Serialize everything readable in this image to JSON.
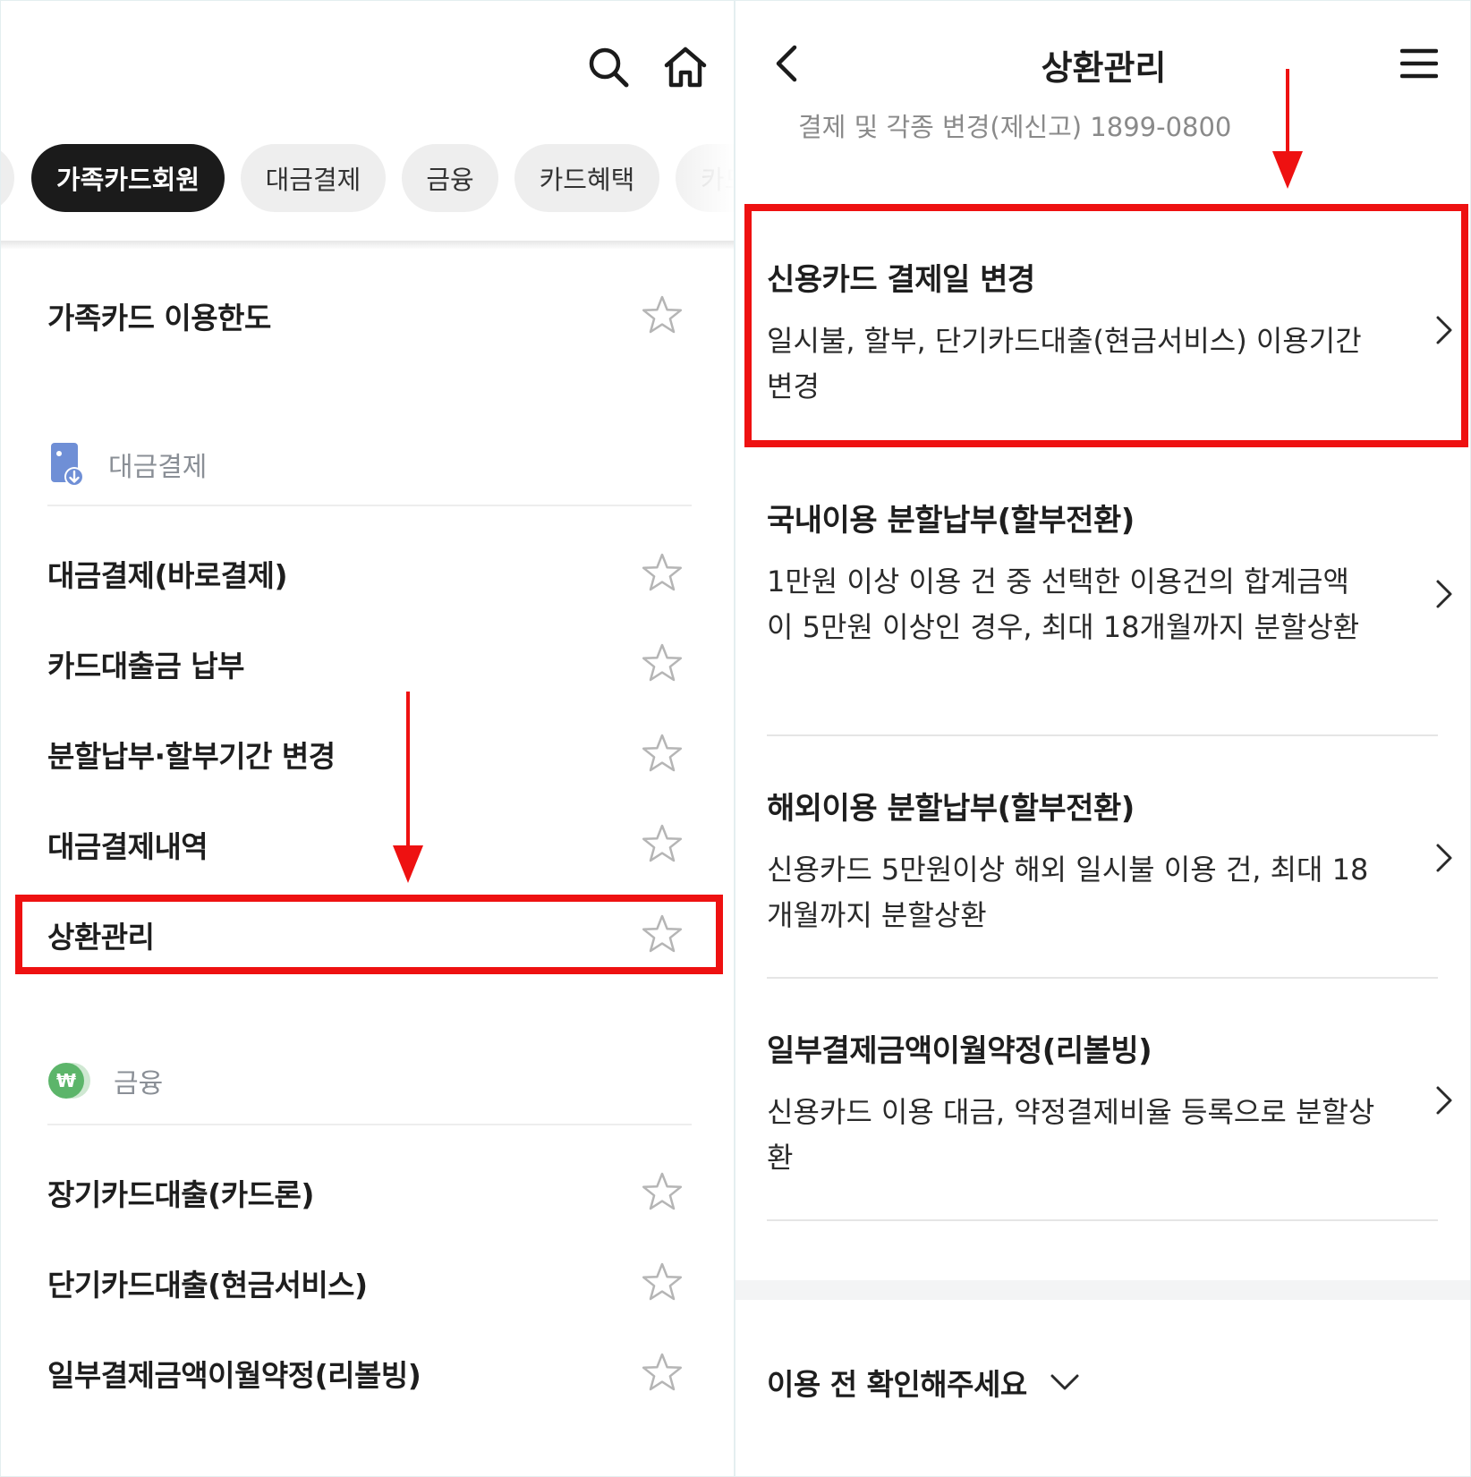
{
  "left": {
    "chips": [
      {
        "label": "가족카드회원",
        "active": true
      },
      {
        "label": "대금결제",
        "active": false
      },
      {
        "label": "금융",
        "active": false
      },
      {
        "label": "카드혜택",
        "active": false
      },
      {
        "label": "카드",
        "active": false
      }
    ],
    "items_family": [
      {
        "label": "가족카드 이용한도"
      }
    ],
    "section_payment": {
      "label": "대금결제"
    },
    "items_payment": [
      {
        "label": "대금결제(바로결제)"
      },
      {
        "label": "카드대출금 납부"
      },
      {
        "label": "분할납부·할부기간 변경"
      },
      {
        "label": "대금결제내역"
      },
      {
        "label": "상환관리"
      }
    ],
    "section_finance": {
      "label": "금융"
    },
    "items_finance": [
      {
        "label": "장기카드대출(카드론)"
      },
      {
        "label": "단기카드대출(현금서비스)"
      },
      {
        "label": "일부결제금액이월약정(리볼빙)"
      }
    ]
  },
  "right": {
    "title": "상환관리",
    "phone_line": "결제 및 각종 변경(제신고) 1899-0800",
    "items": [
      {
        "title": "신용카드 결제일 변경",
        "desc": "일시불, 할부, 단기카드대출(현금서비스) 이용기간 변경"
      },
      {
        "title": "국내이용 분할납부(할부전환)",
        "desc": "1만원 이상 이용 건 중 선택한 이용건의 합계금액이 5만원 이상인 경우, 최대 18개월까지 분할상환"
      },
      {
        "title": "해외이용 분할납부(할부전환)",
        "desc": "신용카드 5만원이상 해외 일시불 이용 건, 최대 18개월까지 분할상환"
      },
      {
        "title": "일부결제금액이월약정(리볼빙)",
        "desc": "신용카드 이용 대금, 약정결제비율 등록으로 분할상환"
      }
    ],
    "confirm_label": "이용 전 확인해주세요"
  },
  "colors": {
    "highlight": "#ee1111",
    "chip_active_bg": "#1b1b1b",
    "chip_bg": "#eeeeee",
    "section_text": "#8a8f96",
    "payment_icon": "#6f8fd6",
    "finance_icon": "#5cb56a"
  },
  "icons": {
    "search": "search-icon",
    "home": "home-icon",
    "star": "star-icon",
    "back": "back-icon",
    "menu": "hamburger-icon",
    "chevron": "chevron-right-icon",
    "expand": "chevron-down-icon"
  }
}
